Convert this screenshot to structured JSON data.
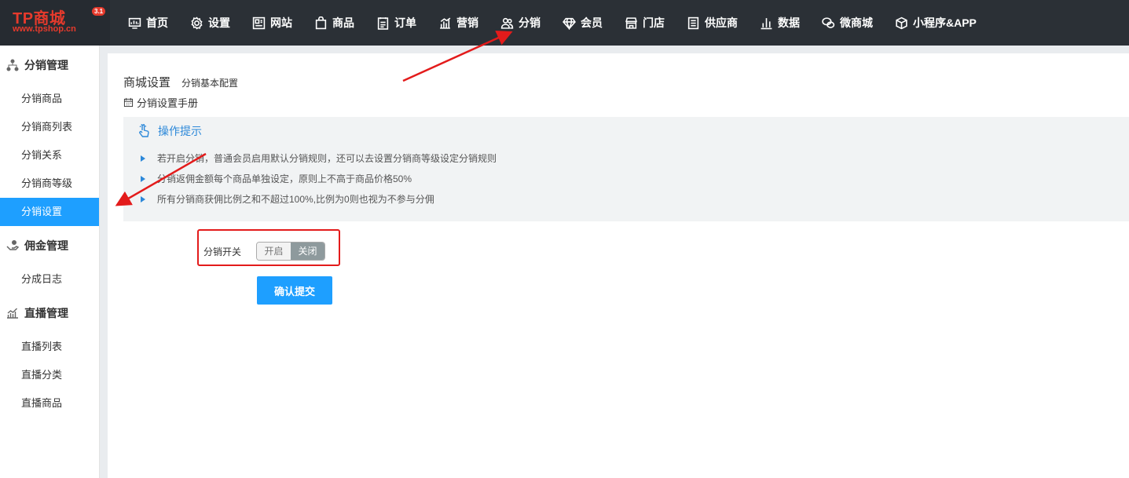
{
  "logo": {
    "text": "TP商城",
    "version": "3.1",
    "url": "www.tpshop.cn"
  },
  "nav": [
    {
      "label": "首页",
      "icon": "monitor-icon"
    },
    {
      "label": "设置",
      "icon": "gear-icon"
    },
    {
      "label": "网站",
      "icon": "website-icon"
    },
    {
      "label": "商品",
      "icon": "bag-icon"
    },
    {
      "label": "订单",
      "icon": "clipboard-icon"
    },
    {
      "label": "营销",
      "icon": "chart-icon"
    },
    {
      "label": "分销",
      "icon": "users-icon"
    },
    {
      "label": "会员",
      "icon": "diamond-icon"
    },
    {
      "label": "门店",
      "icon": "store-icon"
    },
    {
      "label": "供应商",
      "icon": "list-icon"
    },
    {
      "label": "数据",
      "icon": "bar-chart-icon"
    },
    {
      "label": "微商城",
      "icon": "wechat-icon"
    },
    {
      "label": "小程序&APP",
      "icon": "cube-icon"
    }
  ],
  "sidebar": {
    "groups": [
      {
        "label": "分销管理",
        "icon": "hierarchy-icon",
        "items": [
          "分销商品",
          "分销商列表",
          "分销关系",
          "分销商等级",
          "分销设置"
        ]
      },
      {
        "label": "佣金管理",
        "icon": "hand-coin-icon",
        "items": [
          "分成日志"
        ]
      },
      {
        "label": "直播管理",
        "icon": "trend-icon",
        "items": [
          "直播列表",
          "直播分类",
          "直播商品"
        ]
      }
    ],
    "active_item": "分销设置"
  },
  "main": {
    "title": "商城设置",
    "subtitle": "分销基本配置",
    "manual_link": "分销设置手册",
    "tips": {
      "heading": "操作提示",
      "items": [
        "若开启分销，普通会员启用默认分销规则，还可以去设置分销商等级设定分销规则",
        "分销返佣金额每个商品单独设定，原则上不高于商品价格50%",
        "所有分销商获佣比例之和不超过100%,比例为0则也视为不参与分佣"
      ]
    },
    "switch": {
      "label": "分销开关",
      "on_label": "开启",
      "off_label": "关闭",
      "selected": "关闭"
    },
    "submit_label": "确认提交"
  },
  "colors": {
    "accent": "#1e9fff",
    "topbar": "#2b3036",
    "annotation": "#e31b1b"
  }
}
